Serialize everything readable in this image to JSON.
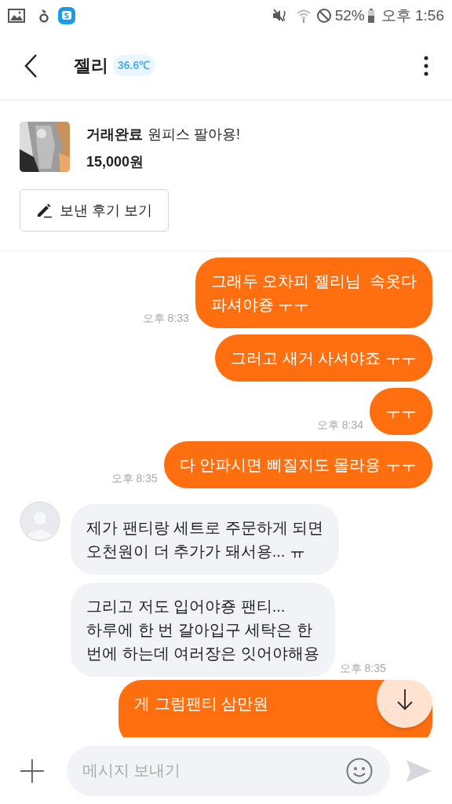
{
  "status_bar": {
    "battery": "52%",
    "time": "오후 1:56"
  },
  "header": {
    "title": "젤리",
    "temperature": "36.6℃"
  },
  "product": {
    "kind": "picture",
    "status": "거래완료",
    "title": "원피스 팔아용!",
    "price": "15,000원",
    "review_button": "보낸 후기 보기"
  },
  "messages": [
    {
      "kind": "sent",
      "text": "그래두 오차피 젤리님  속옷다\n파셔야죵 ㅜㅜ",
      "time": "오후 8:33"
    },
    {
      "kind": "sent",
      "text": "그러고 새거 사셔야죠 ㅜㅜ"
    },
    {
      "kind": "sent",
      "text": "ㅜㅜ",
      "time": "오후 8:34"
    },
    {
      "kind": "sent",
      "text": "다 안파시면 삐질지도 몰라용 ㅜㅜ",
      "time": "오후 8:35"
    },
    {
      "kind": "received",
      "text": "제가 팬티랑 세트로 주문하게 되면\n오천원이 더 추가가 돼서용... ㅠ"
    },
    {
      "kind": "received",
      "text": "그리고 저도 입어야죵 팬티...\n하루에 한 번 갈아입구 세탁은 한\n번에 하는데 여러장은 잇어야해용",
      "time": "오후 8:35"
    },
    {
      "kind": "sent",
      "text": "게 그럼팬티 삼만원"
    }
  ],
  "input": {
    "placeholder": "메시지 보내기"
  }
}
